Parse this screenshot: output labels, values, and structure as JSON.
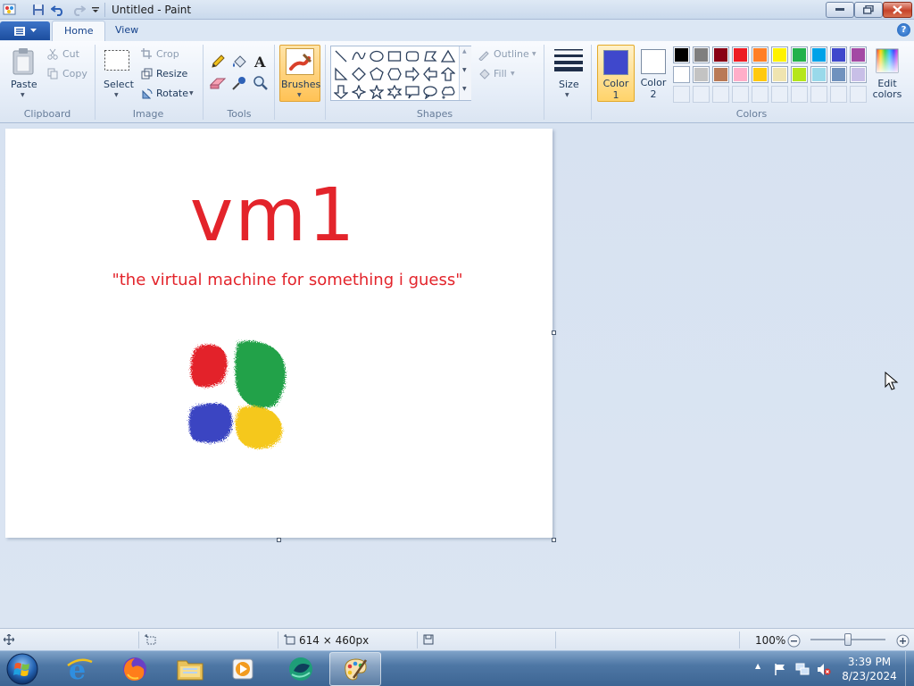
{
  "window": {
    "title": "Untitled - Paint"
  },
  "tabs": {
    "home": "Home",
    "view": "View"
  },
  "clipboard": {
    "paste": "Paste",
    "cut": "Cut",
    "copy": "Copy",
    "group": "Clipboard"
  },
  "image": {
    "select": "Select",
    "crop": "Crop",
    "resize": "Resize",
    "rotate": "Rotate",
    "group": "Image"
  },
  "tools": {
    "group": "Tools"
  },
  "brushes": {
    "label": "Brushes"
  },
  "shapes": {
    "outline": "Outline",
    "fill": "Fill",
    "group": "Shapes"
  },
  "size": {
    "label": "Size"
  },
  "colors": {
    "color1_line1": "Color",
    "color1_line2": "1",
    "color2_line1": "Color",
    "color2_line2": "2",
    "edit_line1": "Edit",
    "edit_line2": "colors",
    "group": "Colors",
    "color1_value": "#3f48cc",
    "color2_value": "#ffffff",
    "palette_row1": [
      "#000000",
      "#7f7f7f",
      "#880015",
      "#ed1c24",
      "#ff7f27",
      "#fff200",
      "#22b14c",
      "#00a2e8",
      "#3f48cc",
      "#a349a4"
    ],
    "palette_row2": [
      "#ffffff",
      "#c3c3c3",
      "#b97a57",
      "#ffaec9",
      "#ffc90e",
      "#efe4b0",
      "#b5e61d",
      "#99d9ea",
      "#7092be",
      "#c8bfe7"
    ]
  },
  "canvas": {
    "title": "vm1",
    "subtitle": "\"the virtual machine for something i guess\"",
    "text_color": "#e3242b",
    "logo_colors": [
      "#e3242b",
      "#22a24a",
      "#3a44c2",
      "#f5c81c"
    ]
  },
  "statusbar": {
    "dimensions": "614 × 460px",
    "zoom": "100%"
  },
  "taskbar": {
    "time": "3:39 PM",
    "date": "8/23/2024"
  }
}
